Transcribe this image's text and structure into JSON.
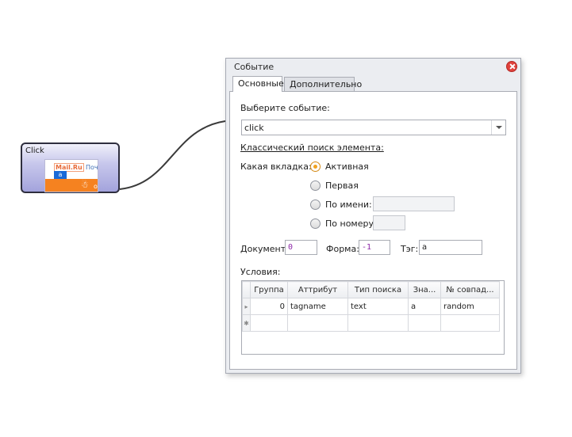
{
  "node": {
    "title": "Click",
    "thumbnail": {
      "logo": "Mail.Ru",
      "badge": "a",
      "link": "Поч",
      "ok_mark": "ok"
    }
  },
  "window": {
    "title": "Событие",
    "tabs": [
      {
        "label": "Основные",
        "active": true
      },
      {
        "label": "Дополнительно",
        "active": false
      }
    ]
  },
  "form": {
    "event_label": "Выберите событие:",
    "event_value": "click",
    "section_label": "Классический поиск элемента:",
    "which_tab_label": "Какая вкладка:",
    "radios": [
      {
        "label": "Активная",
        "checked": true
      },
      {
        "label": "Первая",
        "checked": false
      },
      {
        "label": "По имени:",
        "checked": false
      },
      {
        "label": "По номеру:",
        "checked": false
      }
    ],
    "by_name_value": "",
    "by_number_value": "",
    "document_label": "Документ:",
    "document_value": "0",
    "form_label": "Форма:",
    "form_value": "-1",
    "tag_label": "Тэг:",
    "tag_value": "a",
    "conditions_label": "Условия:"
  },
  "grid": {
    "columns": [
      "",
      "Группа",
      "Аттрибут",
      "Тип поиска",
      "Зна...",
      "№ совпад..."
    ],
    "rows": [
      {
        "indicator": "▸",
        "cells": [
          "0",
          "tagname",
          "text",
          "a",
          "random"
        ]
      },
      {
        "indicator": "✱",
        "cells": [
          "",
          "",
          "",
          "",
          ""
        ]
      }
    ]
  },
  "colors": {
    "accent": "#f2a21e",
    "node_fill": "#a3a3dc",
    "close": "#e0413c",
    "number_text": "#8d28a8"
  }
}
